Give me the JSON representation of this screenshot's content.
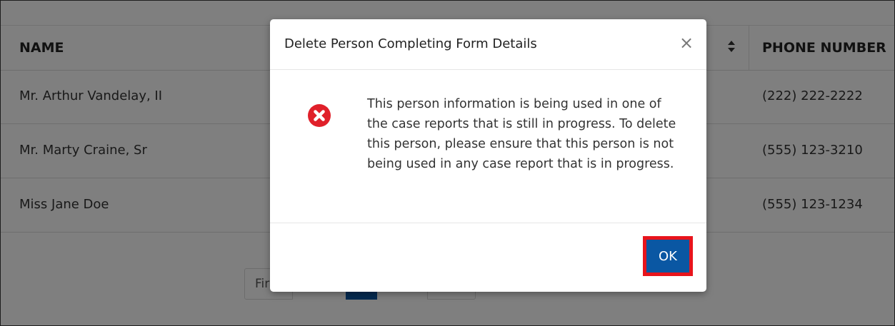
{
  "table": {
    "headers": {
      "name": "NAME",
      "phone": "PHONE NUMBER"
    },
    "rows": [
      {
        "name": "Mr. Arthur Vandelay, II",
        "phone": "(222) 222-2222"
      },
      {
        "name": "Mr. Marty Craine, Sr",
        "phone": "(555) 123-3210"
      },
      {
        "name": "Miss Jane Doe",
        "phone": "(555) 123-1234"
      }
    ]
  },
  "pagination": {
    "first_label_partial": "Fir"
  },
  "modal": {
    "title": "Delete Person Completing Form Details",
    "close_symbol": "×",
    "message": "This person information is being used in one of the case reports that is still in progress. To delete this person, please ensure that this person is not being used in any case report that is in progress.",
    "ok_label": "OK",
    "icon": "error-x-circle-icon"
  },
  "colors": {
    "primary": "#0a57a3",
    "error": "#e0202a",
    "highlight": "#e8141c"
  }
}
